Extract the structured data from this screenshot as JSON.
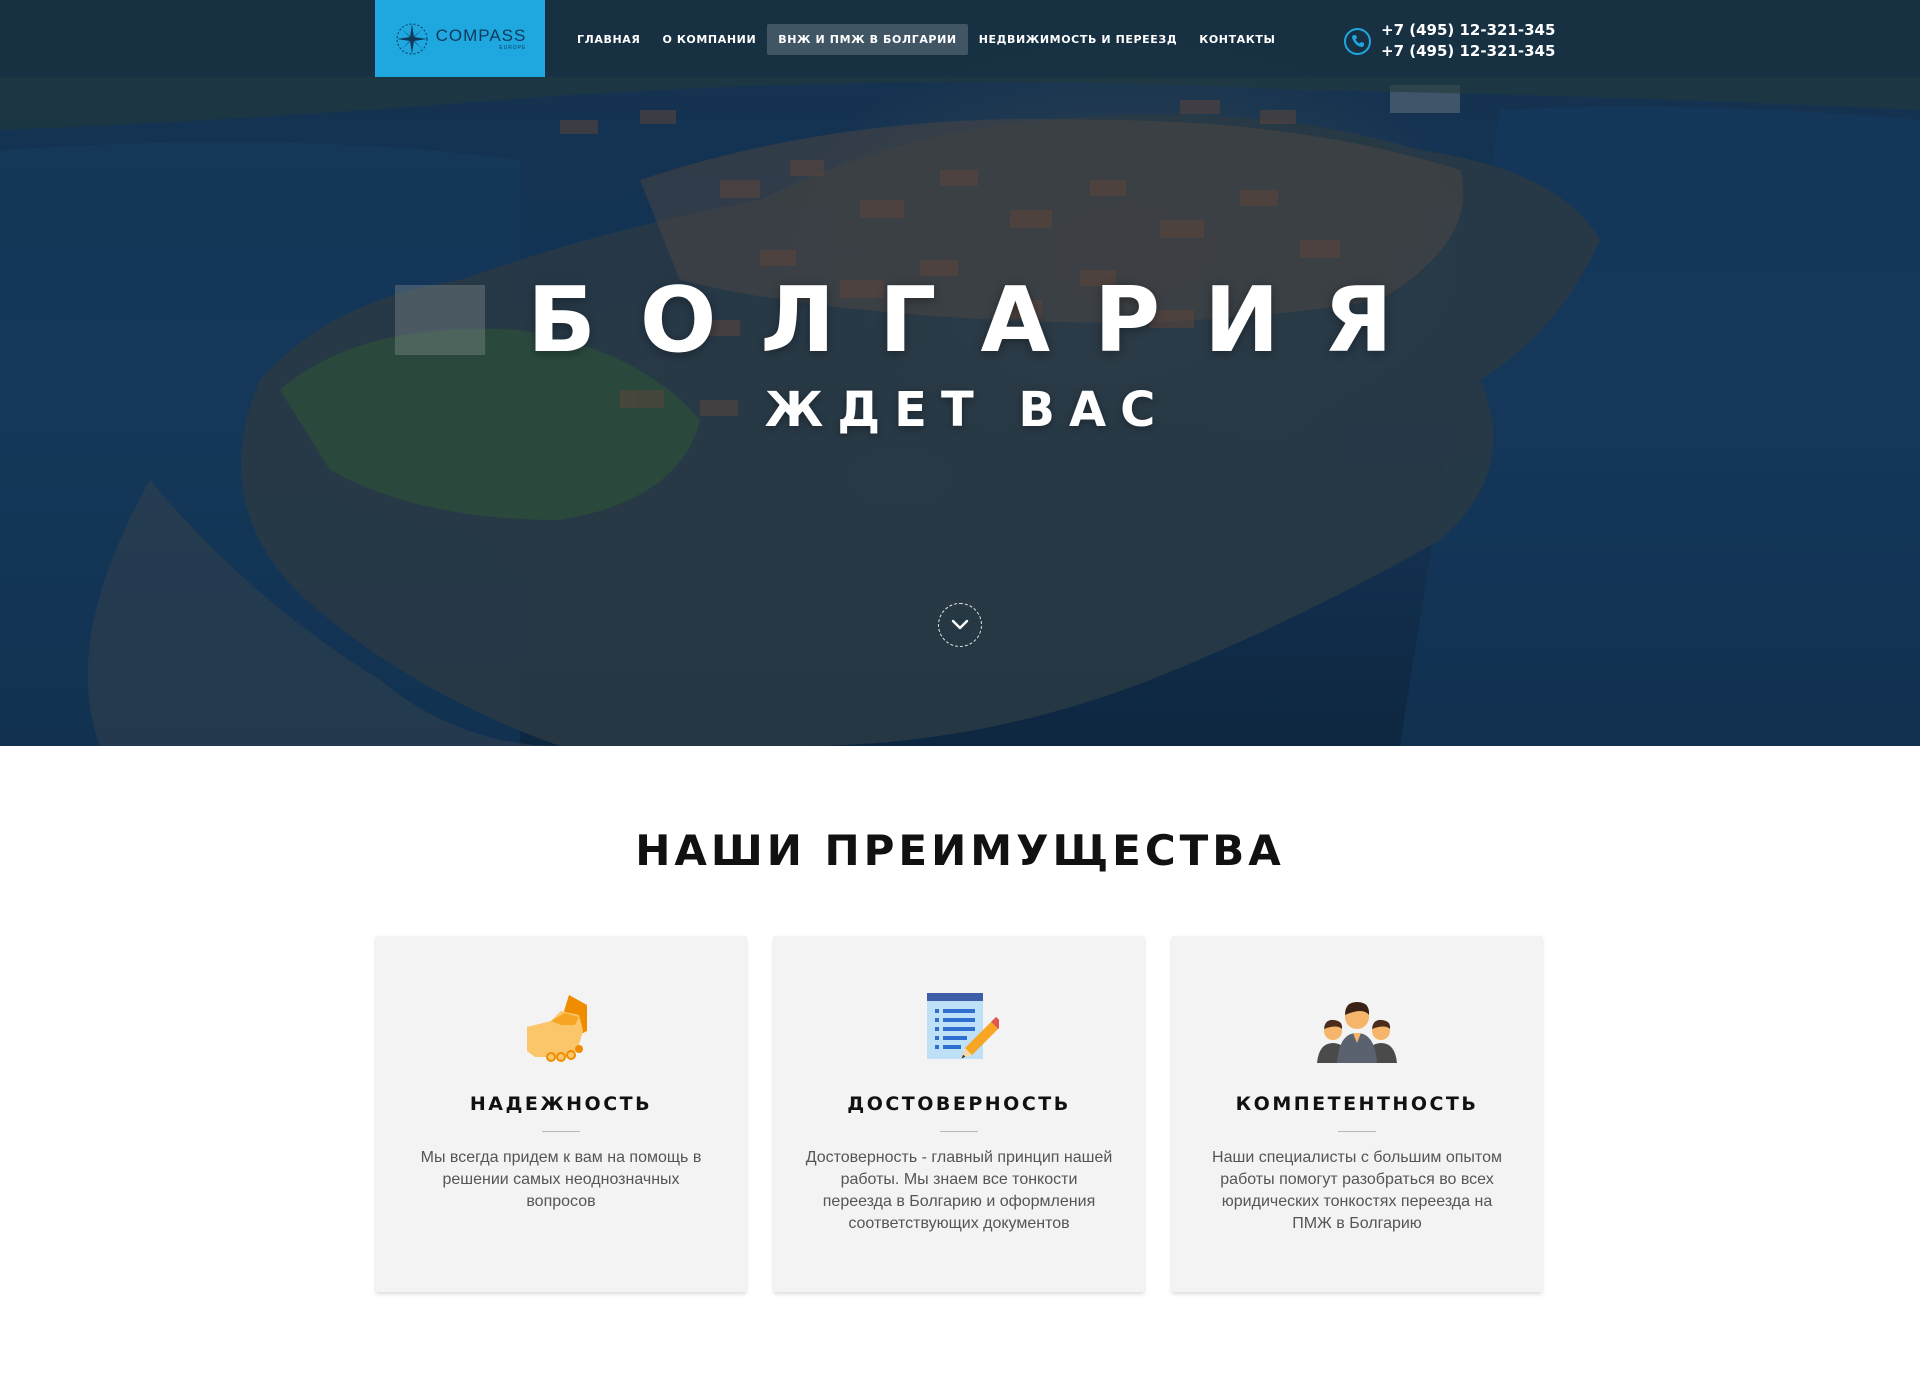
{
  "brand": {
    "name": "COMPASS",
    "sub": "EUROPE",
    "accent_color": "#1fa7e0"
  },
  "nav": {
    "items": [
      {
        "label": "ГЛАВНАЯ"
      },
      {
        "label": "О КОМПАНИИ"
      },
      {
        "label": "ВНЖ И ПМЖ В БОЛГАРИИ",
        "active": true
      },
      {
        "label": "НЕДВИЖИМОСТЬ И ПЕРЕЕЗД"
      },
      {
        "label": "КОНТАКТЫ"
      }
    ]
  },
  "contacts": {
    "phones": [
      "+7 (495) 12-321-345",
      "+7 (495) 12-321-345"
    ],
    "icon": "phone-icon"
  },
  "hero": {
    "title": "БОЛГАРИЯ",
    "subtitle": "ЖДЕТ ВАС",
    "scroll_icon": "chevron-down-icon"
  },
  "advantages": {
    "title": "НАШИ ПРЕИМУЩЕСТВА",
    "cards": [
      {
        "icon": "handshake-icon",
        "title": "НАДЕЖНОСТЬ",
        "text": "Мы всегда придем к вам на помощь в решении самых неоднозначных вопросов"
      },
      {
        "icon": "document-pencil-icon",
        "title": "ДОСТОВЕРНОСТЬ",
        "text": "Достоверность - главный принцип нашей работы. Мы знаем все тонкости переезда в Болгарию и оформления соответствующих документов"
      },
      {
        "icon": "team-icon",
        "title": "КОМПЕТЕНТНОСТЬ",
        "text": "Наши специалисты с большим опытом работы помогут разобраться во всех юридических тонкостях переезда на ПМЖ в Болгарию"
      }
    ]
  }
}
